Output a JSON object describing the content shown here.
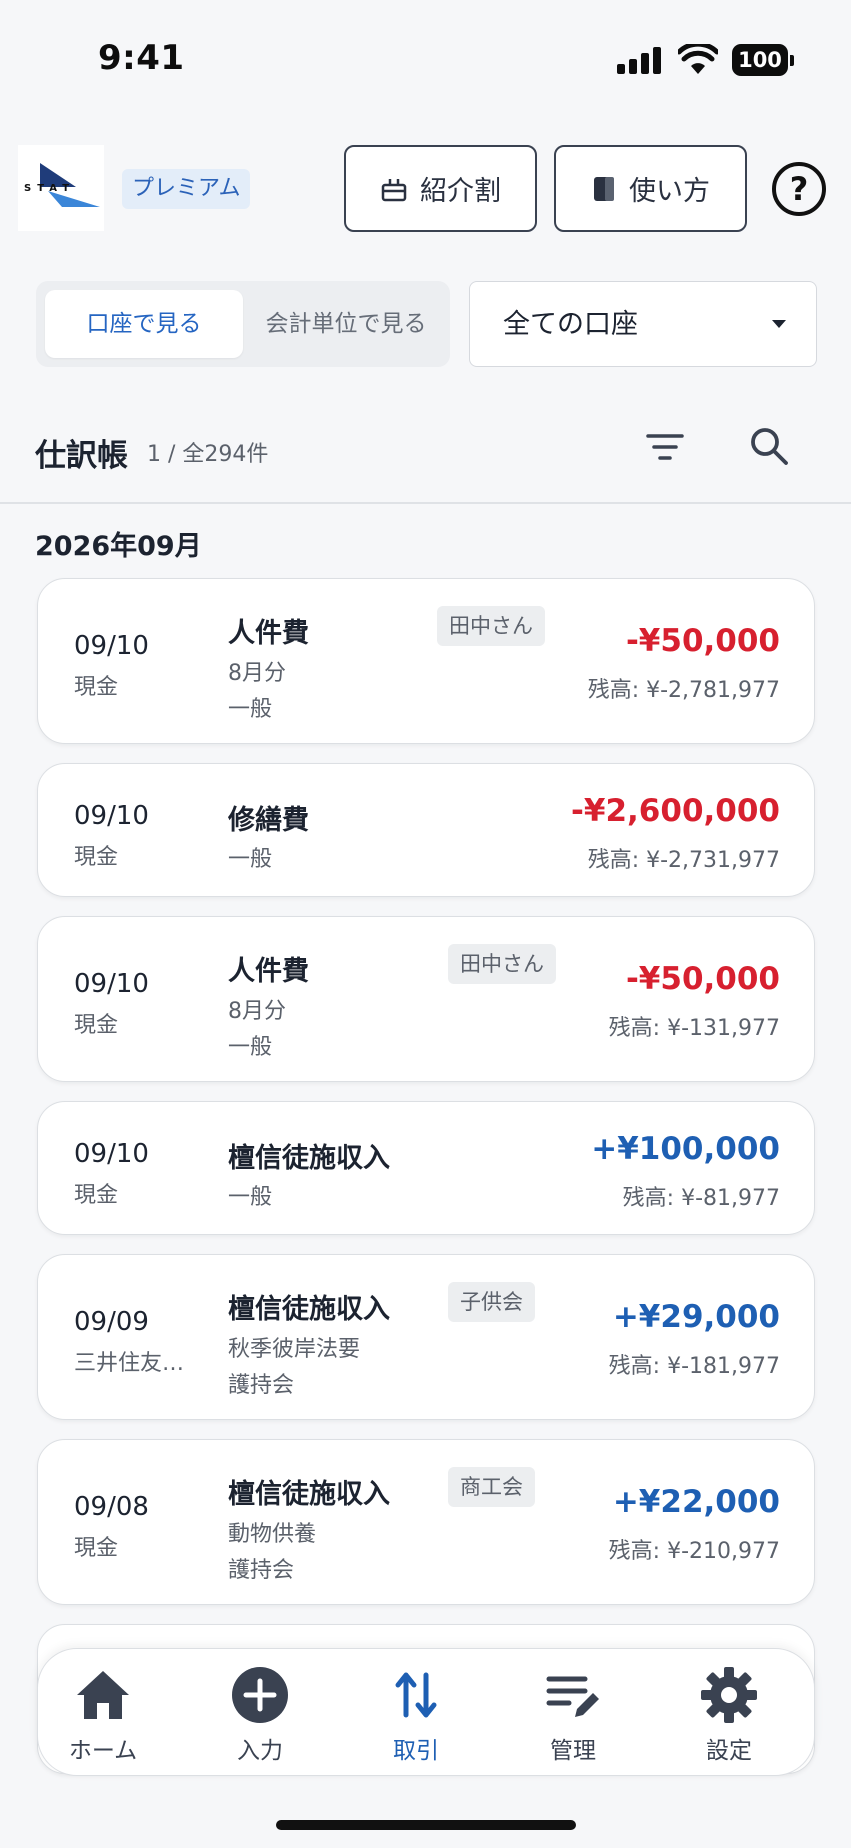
{
  "status_bar": {
    "time": "9:41",
    "battery": "100"
  },
  "header": {
    "logo_text": "STAT",
    "badge": "プレミアム",
    "referral_label": "紹介割",
    "howto_label": "使い方",
    "help_label": "?"
  },
  "view_toggle": {
    "active": "口座で見る",
    "inactive": "会計単位で見る"
  },
  "account_select": {
    "value": "全ての口座"
  },
  "journal": {
    "title": "仕訳帳",
    "count": "1 / 全294件"
  },
  "month": "2026年09月",
  "transactions": [
    {
      "date": "09/10",
      "account": "現金",
      "category": "人件費",
      "memo": "8月分",
      "sub": "一般",
      "tag": "田中さん",
      "amount": "-¥50,000",
      "balance": "残高: ¥-2,781,977"
    },
    {
      "date": "09/10",
      "account": "現金",
      "category": "修繕費",
      "sub": "一般",
      "amount": "-¥2,600,000",
      "balance": "残高: ¥-2,731,977"
    },
    {
      "date": "09/10",
      "account": "現金",
      "category": "人件費",
      "memo": "8月分",
      "sub": "一般",
      "tag": "田中さん",
      "amount": "-¥50,000",
      "balance": "残高: ¥-131,977"
    },
    {
      "date": "09/10",
      "account": "現金",
      "category": "檀信徒施収入",
      "sub": "一般",
      "amount": "+¥100,000",
      "balance": "残高: ¥-81,977"
    },
    {
      "date": "09/09",
      "account": "三井住友…",
      "category": "檀信徒施収入",
      "memo": "秋季彼岸法要",
      "sub": "護持会",
      "tag": "子供会",
      "amount": "+¥29,000",
      "balance": "残高: ¥-181,977"
    },
    {
      "date": "09/08",
      "account": "現金",
      "category": "檀信徒施収入",
      "memo": "動物供養",
      "sub": "護持会",
      "tag": "商工会",
      "amount": "+¥22,000",
      "balance": "残高: ¥-210,977"
    }
  ],
  "bottom_nav": [
    {
      "label": "ホーム",
      "icon": "home-icon"
    },
    {
      "label": "入力",
      "icon": "plus-circle-icon"
    },
    {
      "label": "取引",
      "icon": "transfer-arrows-icon",
      "active": true
    },
    {
      "label": "管理",
      "icon": "edit-list-icon"
    },
    {
      "label": "設定",
      "icon": "gear-icon"
    }
  ],
  "colors": {
    "negative": "#d7202f",
    "positive": "#1e5fb3",
    "accent": "#2565c2"
  }
}
